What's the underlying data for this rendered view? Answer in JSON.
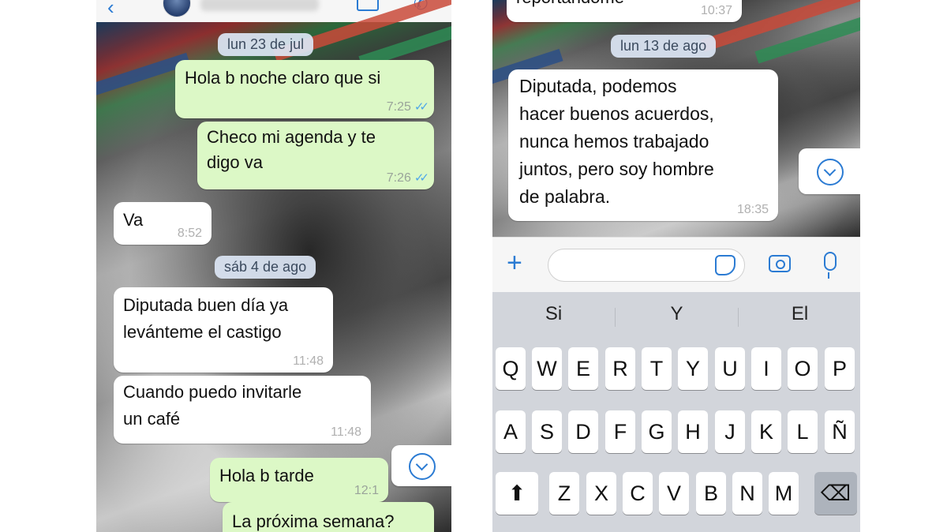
{
  "left_chat": {
    "messages": [
      {
        "type": "date",
        "text": "lun 23 de jul"
      },
      {
        "type": "out",
        "text": "Hola b noche claro que si",
        "time": "7:25"
      },
      {
        "type": "out",
        "line1": "Checo mi agenda y te",
        "line2": "digo va",
        "time": "7:26"
      },
      {
        "type": "in",
        "text": "Va",
        "time": "8:52"
      },
      {
        "type": "date",
        "text": "sáb 4 de ago"
      },
      {
        "type": "in",
        "line1": "Diputada buen día ya",
        "line2": "levánteme el castigo",
        "time": "11:48"
      },
      {
        "type": "in",
        "line1": "Cuando puedo invitarle",
        "line2": "un café",
        "time": "11:48"
      },
      {
        "type": "out",
        "text": "Hola b tarde",
        "time": "12:1"
      },
      {
        "type": "out",
        "text": "La próxima semana?"
      }
    ]
  },
  "right_chat": {
    "partial_message": {
      "text": "reportándome",
      "time": "10:37"
    },
    "date": "lun 13 de ago",
    "message": {
      "lines": [
        "Diputada, podemos",
        "hacer buenos acuerdos,",
        "nunca hemos trabajado",
        "juntos, pero soy hombre",
        "de palabra."
      ],
      "time": "18:35"
    }
  },
  "keyboard": {
    "suggestions": [
      "Si",
      "Y",
      "El"
    ],
    "row1": [
      "Q",
      "W",
      "E",
      "R",
      "T",
      "Y",
      "U",
      "I",
      "O",
      "P"
    ],
    "row2": [
      "A",
      "S",
      "D",
      "F",
      "G",
      "H",
      "J",
      "K",
      "L",
      "Ñ"
    ],
    "row3": [
      "Z",
      "X",
      "C",
      "V",
      "B",
      "N",
      "M"
    ]
  },
  "icons": {
    "back": "chevron-left-icon",
    "video": "video-icon",
    "call": "phone-icon",
    "scroll_down": "chevron-down-circle-icon",
    "plus": "plus-icon",
    "sticker": "sticker-icon",
    "camera": "camera-icon",
    "mic": "microphone-icon",
    "shift": "shift-icon",
    "backspace": "backspace-icon"
  },
  "colors": {
    "accent": "#2b7bd3",
    "outgoing_bubble": "#dcf8c6",
    "incoming_bubble": "#ffffff",
    "read_ticks": "#4fa7e8",
    "keyboard_bg": "#d2d5db"
  }
}
